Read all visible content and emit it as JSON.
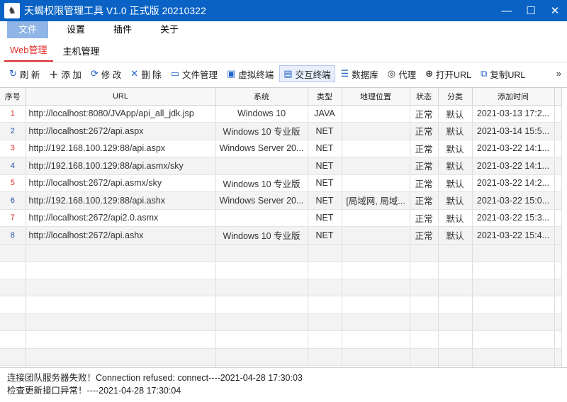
{
  "window": {
    "title": "天蝎权限管理工具 V1.0 正式版 20210322",
    "controls": {
      "minimize": "—",
      "maximize": "☐",
      "close": "✕"
    }
  },
  "menu": [
    "文件",
    "设置",
    "插件",
    "关于"
  ],
  "tabs": [
    "Web管理",
    "主机管理"
  ],
  "toolbar": {
    "refresh": "刷 新",
    "add": "添 加",
    "edit": "修 改",
    "delete": "删 除",
    "file_mgr": "文件管理",
    "virtual_term": "虚拟终端",
    "interactive_term": "交互终端",
    "database": "数据库",
    "proxy": "代理",
    "open_url": "打开URL",
    "copy_url": "复制URL",
    "more": "»"
  },
  "table": {
    "headers": [
      "序号",
      "URL",
      "系统",
      "类型",
      "地理位置",
      "状态",
      "分类",
      "添加时间"
    ],
    "rows": [
      [
        "1",
        "http://localhost:8080/JVApp/api_all_jdk.jsp",
        "Windows 10",
        "JAVA",
        "",
        "正常",
        "默认",
        "2021-03-13 17:2..."
      ],
      [
        "2",
        "http://localhost:2672/api.aspx",
        "Windows 10 专业版",
        "NET",
        "",
        "正常",
        "默认",
        "2021-03-14 15:5..."
      ],
      [
        "3",
        "http://192.168.100.129:88/api.aspx",
        "Windows Server 20...",
        "NET",
        "",
        "正常",
        "默认",
        "2021-03-22 14:1..."
      ],
      [
        "4",
        "http://192.168.100.129:88/api.asmx/sky",
        "",
        "NET",
        "",
        "正常",
        "默认",
        "2021-03-22 14:1..."
      ],
      [
        "5",
        "http://localhost:2672/api.asmx/sky",
        "Windows 10 专业版",
        "NET",
        "",
        "正常",
        "默认",
        "2021-03-22 14:2..."
      ],
      [
        "6",
        "http://192.168.100.129:88/api.ashx",
        "Windows Server 20...",
        "NET",
        "[局域网, 局域...",
        "正常",
        "默认",
        "2021-03-22 15:0..."
      ],
      [
        "7",
        "http://localhost:2672/api2.0.asmx",
        "",
        "NET",
        "",
        "正常",
        "默认",
        "2021-03-22 15:3..."
      ],
      [
        "8",
        "http://localhost:2672/api.ashx",
        "Windows 10 专业版",
        "NET",
        "",
        "正常",
        "默认",
        "2021-03-22 15:4..."
      ]
    ]
  },
  "status": {
    "line1": "连接团队服务器失败！Connection refused: connect----2021-04-28 17:30:03",
    "line2": "检查更新接口异常！----2021-04-28 17:30:04"
  },
  "colors": {
    "titlebar": "#0a63c4",
    "accent_tab": "#e02d2d",
    "menu_active": "#8fb4e6"
  }
}
